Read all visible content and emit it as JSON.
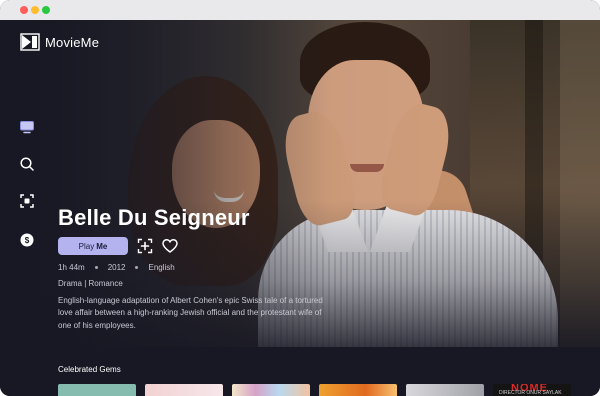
{
  "app": {
    "name": "MovieMe"
  },
  "window": {
    "controls": [
      "close",
      "minimize",
      "zoom"
    ]
  },
  "sidebar": {
    "items": [
      {
        "icon": "tv-icon",
        "label": ""
      },
      {
        "icon": "search-icon",
        "label": ""
      },
      {
        "icon": "scan-icon",
        "label": ""
      },
      {
        "icon": "coin-icon",
        "label": ""
      }
    ]
  },
  "featured": {
    "title": "Belle Du Seigneur",
    "play_label_regular": "Play",
    "play_label_bold": "Me",
    "duration": "1h 44m",
    "year": "2012",
    "language": "English",
    "genres": "Drama | Romance",
    "description": "English-language adaptation of Albert Cohen's epic Swiss tale of a tortured love affair between a high-ranking Jewish official and the protestant wife of one of his employees."
  },
  "section": {
    "title": "Celebrated Gems",
    "posters": [
      {
        "text": "",
        "credit": ""
      },
      {
        "text": "",
        "credit": ""
      },
      {
        "text": "",
        "credit": ""
      },
      {
        "text": "",
        "credit": ""
      },
      {
        "text": "",
        "credit": ""
      },
      {
        "text": "NOME",
        "credit": "DIRECTOR ONUR SAYLAK"
      }
    ]
  },
  "colors": {
    "background": "#181824",
    "accent": "#b4b3ef",
    "text_primary": "#ffffff",
    "text_secondary": "#c9c9d4"
  }
}
